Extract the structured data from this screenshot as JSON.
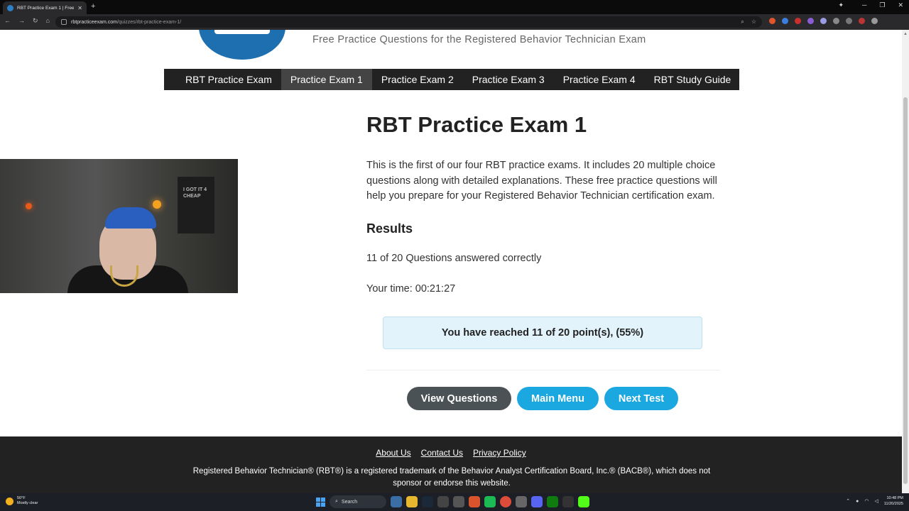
{
  "browser": {
    "tab_title": "RBT Practice Exam 1 | Free Prac",
    "url_domain": "rbtpracticeexam.com",
    "url_path": "/quizzes/rbt-practice-exam-1/"
  },
  "header": {
    "tagline": "Free Practice Questions for the Registered Behavior Technician Exam"
  },
  "nav": {
    "items": [
      {
        "label": "RBT Practice Exam"
      },
      {
        "label": "Practice Exam 1"
      },
      {
        "label": "Practice Exam 2"
      },
      {
        "label": "Practice Exam 3"
      },
      {
        "label": "Practice Exam 4"
      },
      {
        "label": "RBT Study Guide"
      }
    ],
    "active_index": 1
  },
  "webcam": {
    "poster_text": "I GOT IT 4 CHEAP"
  },
  "main": {
    "title": "RBT Practice Exam 1",
    "intro": "This is the first of our four RBT practice exams. It includes 20 multiple choice questions along with detailed explanations. These free practice questions will help you prepare for your Registered Behavior Technician certification exam.",
    "results_heading": "Results",
    "score_text": "11 of 20 Questions answered correctly",
    "time_label": "Your time:",
    "time_value": "00:21:27",
    "points_text": "You have reached 11 of 20 point(s), (55%)",
    "buttons": {
      "view_questions": "View Questions",
      "main_menu": "Main Menu",
      "next_test": "Next Test"
    }
  },
  "footer": {
    "links": {
      "about": "About Us",
      "contact": "Contact Us",
      "privacy": "Privacy Policy"
    },
    "disclaimer": "Registered Behavior Technician® (RBT®) is a registered trademark of the Behavior Analyst Certification Board, Inc.® (BACB®), which does not sponsor or endorse this website."
  },
  "taskbar": {
    "weather_temp": "50°F",
    "weather_desc": "Mostly clear",
    "search_label": "Search",
    "time": "10:48 PM",
    "date": "11/20/2025"
  },
  "colors": {
    "nav_bg": "#222222",
    "nav_active": "#444444",
    "button_dark": "#4a5255",
    "button_blue": "#1ba8e0",
    "points_bg": "#e2f3fb",
    "logo_blue": "#1d6fb0"
  }
}
